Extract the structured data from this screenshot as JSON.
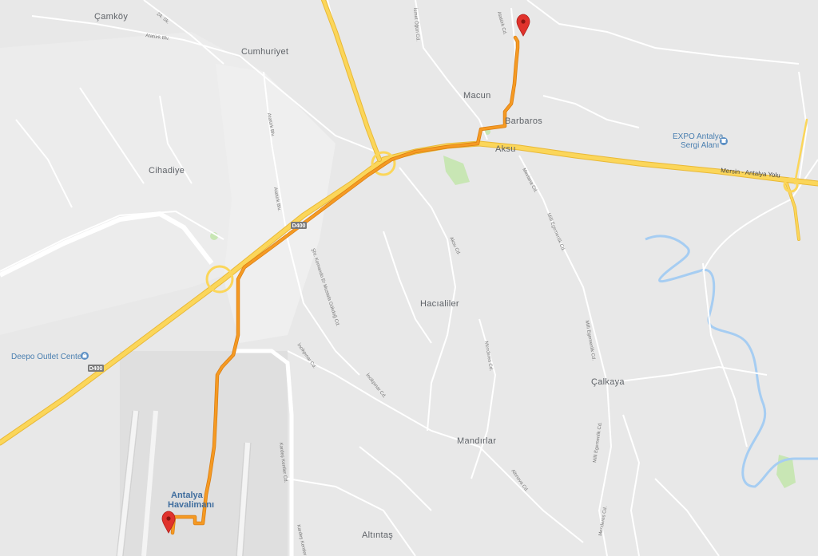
{
  "colors": {
    "land": "#e8e8e8",
    "road": "#ffffff",
    "highway": "#fbd65a",
    "highway_edge": "#e9b937",
    "route": "#f59a23",
    "water": "#a6cdf2",
    "park": "#c8e6b4",
    "pin": "#e0322c",
    "poi_blue": "#5b8fc4"
  },
  "places": [
    {
      "name": "Çamköy"
    },
    {
      "name": "Cumhuriyet"
    },
    {
      "name": "Macun"
    },
    {
      "name": "Barbaros"
    },
    {
      "name": "Aksu"
    },
    {
      "name": "Cihadiye"
    },
    {
      "name": "Hacıaliler"
    },
    {
      "name": "Çalkaya"
    },
    {
      "name": "Mandırlar"
    },
    {
      "name": "Altıntaş"
    }
  ],
  "pois": [
    {
      "line1": "EXPO Antalya",
      "line2": "Sergi Alanı",
      "icon": "museum-icon"
    },
    {
      "line1": "Deepo Outlet Center",
      "icon": "shopping-icon"
    }
  ],
  "airport": {
    "line1": "Antalya",
    "line2": "Havalimanı"
  },
  "highway_labels": [
    "Mersin - Antalya Yolu"
  ],
  "route_shields": [
    "D400",
    "D400"
  ],
  "streets": [
    "24. Sk.",
    "Atatürk Blv.",
    "İsmet Öğün Cd.",
    "Atatürk Cd.",
    "Atatürk Blv.",
    "Atatürk Blv.",
    "Mevlana Cd.",
    "Milli Egemenlik Cd.",
    "Aksu Cd.",
    "Şht. Komando Er Mustafa Gökdoğ Cd.",
    "İncikpınar Cd.",
    "Menderes Cd.",
    "Milli Egemenlik Cd.",
    "İncikpınar Cd.",
    "Kardeş Kentler Cd.",
    "Altınova Cd.",
    "Milli Egemenlik Cd.",
    "Kardeş Kentler Cd.",
    "Menderes Cd."
  ],
  "markers": [
    {
      "name": "origin-marker-icon"
    },
    {
      "name": "destination-marker-icon"
    }
  ]
}
